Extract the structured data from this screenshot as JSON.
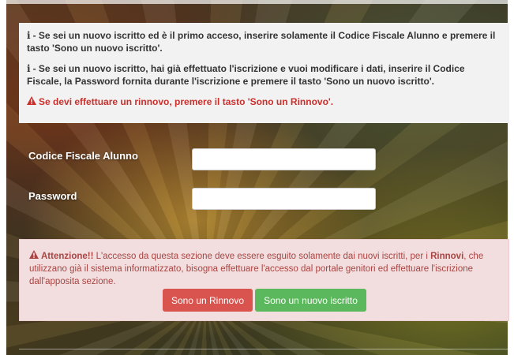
{
  "info_panel": {
    "line1": "- Se sei un nuovo iscritto ed è il primo acceso, inserire solamente il Codice Fiscale Alunno e premere il tasto 'Sono un nuovo iscritto'.",
    "line2": "- Se sei un nuovo iscritto, hai già effettuato l'iscrizione e vuoi modificare i dati, inserire il Codice Fiscale, la Password fornita durante l'iscrizione e premere il tasto 'Sono un nuovo iscritto'.",
    "warning": "Se devi effettuare un rinnovo, premere il tasto 'Sono un Rinnovo'.",
    "info_icon": "info-icon",
    "warning_icon": "warning-triangle-icon"
  },
  "form": {
    "codice_fiscale_label": "Codice Fiscale Alunno",
    "codice_fiscale_value": "",
    "password_label": "Password",
    "password_value": ""
  },
  "alert": {
    "title": "Attenzione!!",
    "text_before": " L'accesso da questa sezione deve essere esguito solamente dai nuovi iscritti, per i ",
    "rinnovi": "Rinnovi",
    "text_after": ", che utilizzano già il sistema informatizzato, bisogna effettuare l'accesso dal portale genitori ed effettuare l'iscrizione dall'apposita sezione."
  },
  "buttons": {
    "rinnovo": "Sono un Rinnovo",
    "nuovo_iscritto": "Sono un nuovo iscritto"
  },
  "colors": {
    "danger": "#d9534f",
    "success": "#5cb85c",
    "alert_bg": "#f2dede",
    "alert_text": "#a94442",
    "warning_red": "#c9302c"
  }
}
